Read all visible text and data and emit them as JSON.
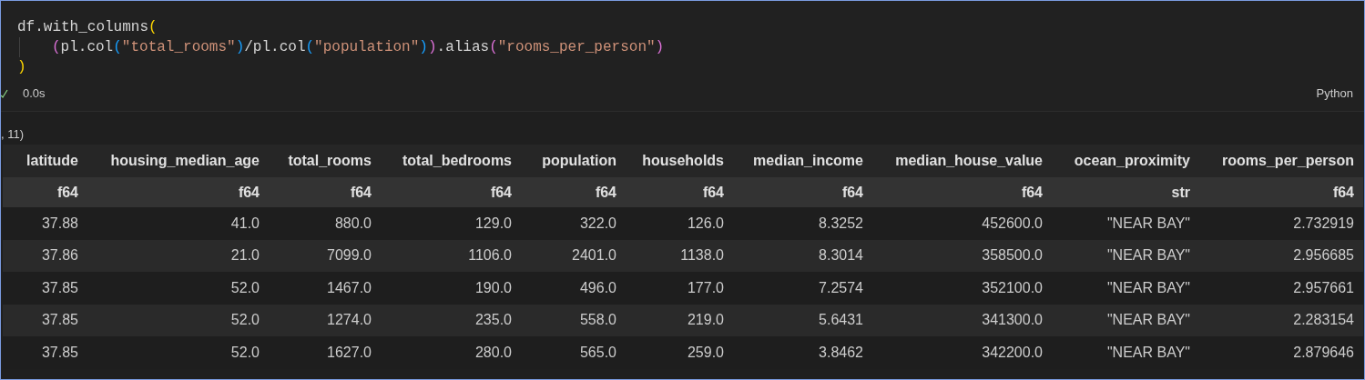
{
  "code_cell": {
    "lines": [
      {
        "indented": false,
        "tokens": [
          {
            "kind": "plain",
            "text": "df.with_columns"
          },
          {
            "kind": "paren1",
            "text": "("
          }
        ]
      },
      {
        "indented": true,
        "tokens": [
          {
            "kind": "paren2",
            "text": "("
          },
          {
            "kind": "plain",
            "text": "pl.col"
          },
          {
            "kind": "paren3",
            "text": "("
          },
          {
            "kind": "string",
            "text": "\"total_rooms\""
          },
          {
            "kind": "paren3",
            "text": ")"
          },
          {
            "kind": "plain",
            "text": "/pl.col"
          },
          {
            "kind": "paren3",
            "text": "("
          },
          {
            "kind": "string",
            "text": "\"population\""
          },
          {
            "kind": "paren3",
            "text": ")"
          },
          {
            "kind": "paren2",
            "text": ")"
          },
          {
            "kind": "plain",
            "text": ".alias"
          },
          {
            "kind": "paren2",
            "text": "("
          },
          {
            "kind": "string",
            "text": "\"rooms_per_person\""
          },
          {
            "kind": "paren2",
            "text": ")"
          }
        ]
      },
      {
        "indented": false,
        "tokens": [
          {
            "kind": "paren1",
            "text": ")"
          }
        ]
      }
    ],
    "status": {
      "succeeded": true,
      "duration": "0.0s",
      "language": "Python"
    }
  },
  "output": {
    "shape": ", 11)",
    "table": {
      "columns": [
        {
          "name": "latitude",
          "dtype": "f64"
        },
        {
          "name": "housing_median_age",
          "dtype": "f64"
        },
        {
          "name": "total_rooms",
          "dtype": "f64"
        },
        {
          "name": "total_bedrooms",
          "dtype": "f64"
        },
        {
          "name": "population",
          "dtype": "f64"
        },
        {
          "name": "households",
          "dtype": "f64"
        },
        {
          "name": "median_income",
          "dtype": "f64"
        },
        {
          "name": "median_house_value",
          "dtype": "f64"
        },
        {
          "name": "ocean_proximity",
          "dtype": "str"
        },
        {
          "name": "rooms_per_person",
          "dtype": "f64"
        }
      ],
      "rows": [
        [
          "37.88",
          "41.0",
          "880.0",
          "129.0",
          "322.0",
          "126.0",
          "8.3252",
          "452600.0",
          "\"NEAR BAY\"",
          "2.732919"
        ],
        [
          "37.86",
          "21.0",
          "7099.0",
          "1106.0",
          "2401.0",
          "1138.0",
          "8.3014",
          "358500.0",
          "\"NEAR BAY\"",
          "2.956685"
        ],
        [
          "37.85",
          "52.0",
          "1467.0",
          "190.0",
          "496.0",
          "177.0",
          "7.2574",
          "352100.0",
          "\"NEAR BAY\"",
          "2.957661"
        ],
        [
          "37.85",
          "52.0",
          "1274.0",
          "235.0",
          "558.0",
          "219.0",
          "5.6431",
          "341300.0",
          "\"NEAR BAY\"",
          "2.283154"
        ],
        [
          "37.85",
          "52.0",
          "1627.0",
          "280.0",
          "565.0",
          "259.0",
          "3.8462",
          "342200.0",
          "\"NEAR BAY\"",
          "2.879646"
        ]
      ]
    }
  }
}
